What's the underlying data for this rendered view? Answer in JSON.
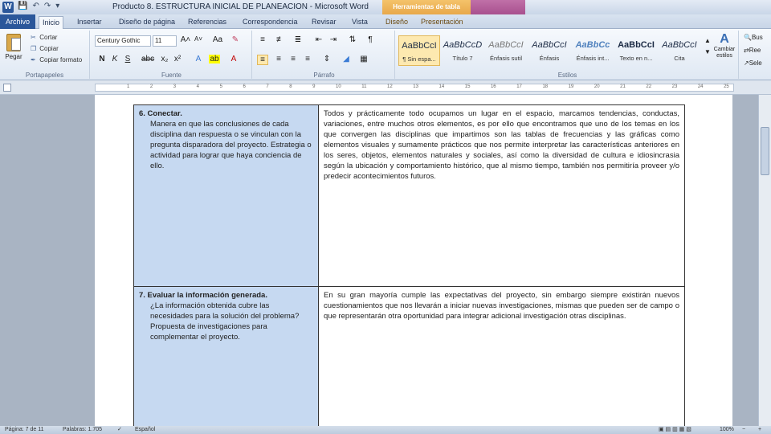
{
  "window": {
    "title": "Producto 8. ESTRUCTURA INICIAL DE PLANEACION  -  Microsoft Word",
    "tools_group_label": "Herramientas de tabla"
  },
  "tabs": {
    "file": "Archivo",
    "home": "Inicio",
    "insert": "Insertar",
    "page_layout": "Diseño de página",
    "references": "Referencias",
    "mailings": "Correspondencia",
    "review": "Revisar",
    "view": "Vista",
    "design": "Diseño",
    "layout": "Presentación"
  },
  "clipboard": {
    "paste": "Pegar",
    "cut": "Cortar",
    "copy": "Copiar",
    "format_painter": "Copiar formato",
    "group_label": "Portapapeles"
  },
  "font": {
    "name": "Century Gothic",
    "size": "11",
    "group_label": "Fuente"
  },
  "paragraph": {
    "group_label": "Párrafo"
  },
  "styles": {
    "group_label": "Estilos",
    "items": [
      {
        "sample": "AaBbCcI",
        "name": "¶ Sin espa..."
      },
      {
        "sample": "AaBbCcD",
        "name": "Título 7"
      },
      {
        "sample": "AaBbCcI",
        "name": "Énfasis sutil"
      },
      {
        "sample": "AaBbCcI",
        "name": "Énfasis"
      },
      {
        "sample": "AaBbCc",
        "name": "Énfasis int..."
      },
      {
        "sample": "AaBbCcI",
        "name": "Texto en n..."
      },
      {
        "sample": "AaBbCcI",
        "name": "Cita"
      }
    ],
    "change_styles": "Cambiar estilos"
  },
  "editing": {
    "find": "Bus",
    "replace": "Ree",
    "select": "Sele"
  },
  "table": {
    "rows": [
      {
        "left_title": "6. Conectar.",
        "left_text": "Manera en que las conclusiones de cada disciplina dan respuesta o se vinculan con la pregunta disparadora del proyecto. Estrategia o actividad para lograr que haya conciencia de ello.",
        "right_text": "Todos y prácticamente todo ocupamos un lugar en el espacio, marcamos tendencias, conductas, variaciones, entre muchos otros elementos, es por ello que encontramos que uno de los temas en los que convergen las disciplinas que impartimos son las tablas de frecuencias y las gráficas como elementos visuales y sumamente prácticos que nos permite interpretar las características anteriores en los seres, objetos, elementos naturales y sociales, así como la diversidad de cultura e idiosincrasia según la ubicación y comportamiento histórico, que al mismo tiempo, también nos permitiría proveer y/o predecir acontecimientos futuros."
      },
      {
        "left_title": "7. Evaluar la información generada.",
        "left_text": "¿La información obtenida cubre las necesidades para la solución del problema? Propuesta de investigaciones para complementar el proyecto.",
        "right_text": "En su gran mayoría cumple las expectativas del proyecto, sin embargo siempre existirán nuevos cuestionamientos que nos llevarán a iniciar nuevas investigaciones, mismas que pueden ser de campo o que representarán otra oportunidad para integrar adicional investigación otras disciplinas."
      }
    ]
  },
  "status": {
    "page": "Página: 7 de 11",
    "words": "Palabras: 1.705",
    "language": "Español",
    "zoom": "100%"
  }
}
